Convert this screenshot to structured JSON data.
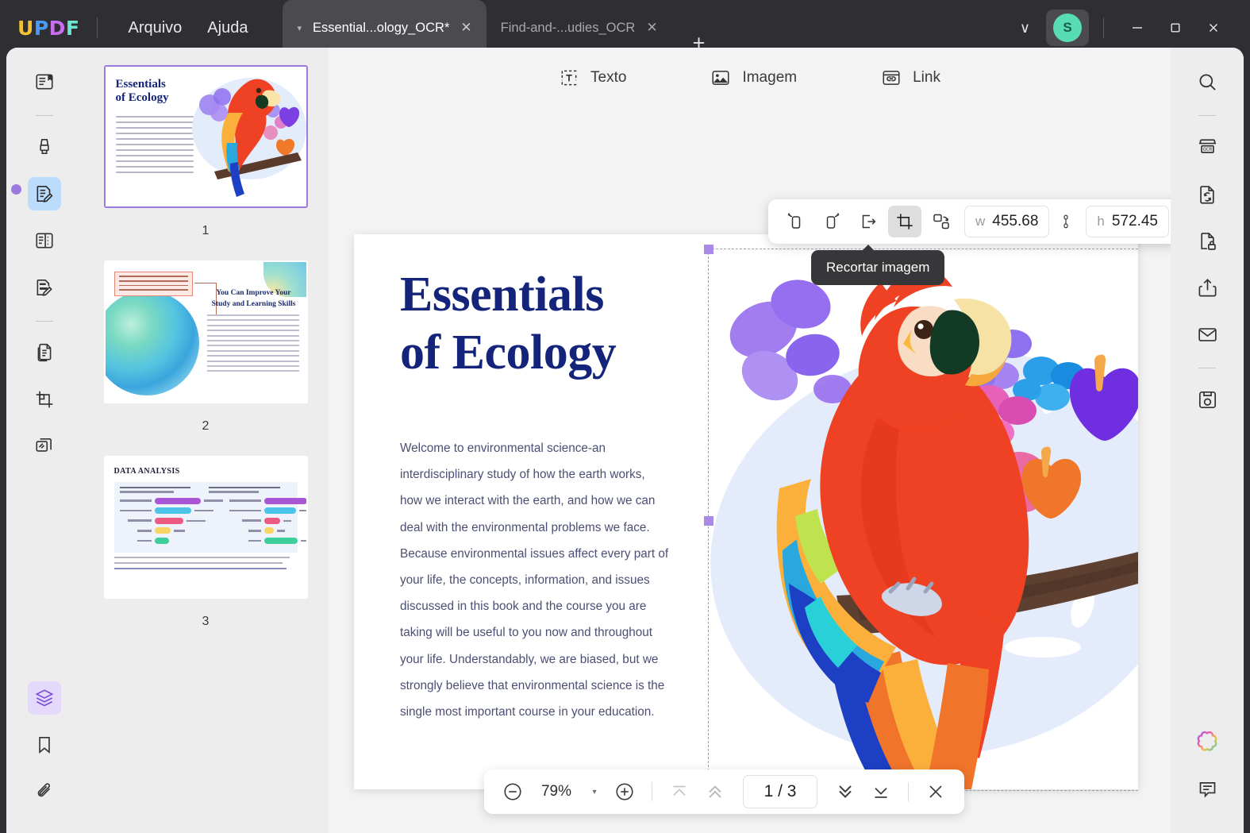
{
  "titlebar": {
    "logo": "UPDF",
    "menus": [
      {
        "label": "Arquivo",
        "name": "menu-arquivo"
      },
      {
        "label": "Ajuda",
        "name": "menu-ajuda"
      }
    ],
    "tabs": [
      {
        "label": "Essential...ology_OCR*",
        "active": true
      },
      {
        "label": "Find-and-...udies_OCR",
        "active": false
      }
    ],
    "new_tab_glyph": "+",
    "tab_close_glyph": "✕",
    "tab_caret_glyph": "▾",
    "chevron_glyph": "∨",
    "avatar_initial": "S",
    "window": {
      "minimize": "—",
      "maximize": "☐",
      "close": "✕"
    }
  },
  "left_rail": {
    "items": [
      {
        "name": "reader-mode-icon",
        "label": "Leitor"
      },
      {
        "name": "highlighter-icon",
        "label": "Marcador"
      },
      {
        "name": "edit-pdf-icon",
        "label": "Editar PDF",
        "selected": true
      },
      {
        "name": "form-icon",
        "label": "Formulario"
      },
      {
        "name": "comment-icon",
        "label": "Comentario"
      },
      {
        "name": "organize-pages-icon",
        "label": "Organizar paginas"
      },
      {
        "name": "crop-page-icon",
        "label": "Cortar pagina"
      },
      {
        "name": "batch-icon",
        "label": "Lote"
      }
    ],
    "bottom_items": [
      {
        "name": "layers-icon",
        "label": "Camadas",
        "selected": true
      },
      {
        "name": "bookmark-icon",
        "label": "Marcador de pagina"
      },
      {
        "name": "attachment-icon",
        "label": "Anexos"
      }
    ]
  },
  "right_rail": {
    "items": [
      {
        "name": "search-icon",
        "label": "Pesquisar"
      },
      {
        "name": "ocr-icon",
        "label": "OCR"
      },
      {
        "name": "convert-icon",
        "label": "Converter"
      },
      {
        "name": "protect-icon",
        "label": "Proteger"
      },
      {
        "name": "share-icon",
        "label": "Compartilhar"
      },
      {
        "name": "email-icon",
        "label": "E-mail"
      },
      {
        "name": "save-icon",
        "label": "Salvar"
      }
    ],
    "bottom_items": [
      {
        "name": "ai-assistant-icon",
        "label": "Assistente IA"
      },
      {
        "name": "comment-balloon-icon",
        "label": "Comentarios"
      }
    ]
  },
  "thumbnails": [
    {
      "page": "1",
      "selected": true
    },
    {
      "page": "2",
      "selected": false
    },
    {
      "page": "3",
      "selected": false
    }
  ],
  "top_toolbar": [
    {
      "label": "Texto",
      "icon": "text-icon"
    },
    {
      "label": "Imagem",
      "icon": "image-icon"
    },
    {
      "label": "Link",
      "icon": "link-icon"
    }
  ],
  "image_toolbar": {
    "buttons": [
      {
        "name": "rotate-left-button",
        "label": "Girar a esquerda"
      },
      {
        "name": "rotate-right-button",
        "label": "Girar a direita"
      },
      {
        "name": "extract-image-button",
        "label": "Extrair imagem"
      },
      {
        "name": "crop-image-button",
        "label": "Recortar imagem",
        "active": true
      },
      {
        "name": "replace-image-button",
        "label": "Substituir imagem"
      }
    ],
    "width_key": "w",
    "width_value": "455.68",
    "height_key": "h",
    "height_value": "572.45",
    "lock_ratio_name": "link-ratio-toggle",
    "tooltip": "Recortar imagem"
  },
  "document": {
    "title_line1": "Essentials",
    "title_line2": "of Ecology",
    "paragraph": [
      "Welcome to environmental science-an",
      "interdisciplinary study of how the earth works,",
      "how we interact with the earth, and how we can",
      "deal with the environmental problems we face.",
      "Because environmental issues affect every part of",
      "your life, the concepts, information, and issues",
      "discussed in this book and the course you are",
      "taking will be useful to you now and throughout",
      "your life. Understandably, we are biased, but we",
      "strongly believe that environmental science is the",
      "single most important course in your education."
    ]
  },
  "thumb_page2": {
    "heading_line1": "You Can Improve Your",
    "heading_line2": "Study and Learning Skills"
  },
  "thumb_page3": {
    "heading": "DATA ANALYSIS"
  },
  "bottom_bar": {
    "zoom_out": "−",
    "zoom_value": "79%",
    "zoom_in": "+",
    "zoom_caret": "▾",
    "page_indicator": "1 / 3",
    "first_page_name": "first-page-button",
    "prev_page_name": "previous-page-button",
    "next_page_name": "next-page-button",
    "last_page_name": "last-page-button",
    "close_name": "close-toolbar-button",
    "close_glyph": "✕"
  },
  "colors": {
    "accent_purple": "#9b7ae0",
    "selection_blue": "#bcdcfb",
    "title_navy": "#14247a",
    "body_text": "#4b4f73",
    "titlebar_bg": "#2f2f33",
    "panel_bg": "#ededed"
  }
}
